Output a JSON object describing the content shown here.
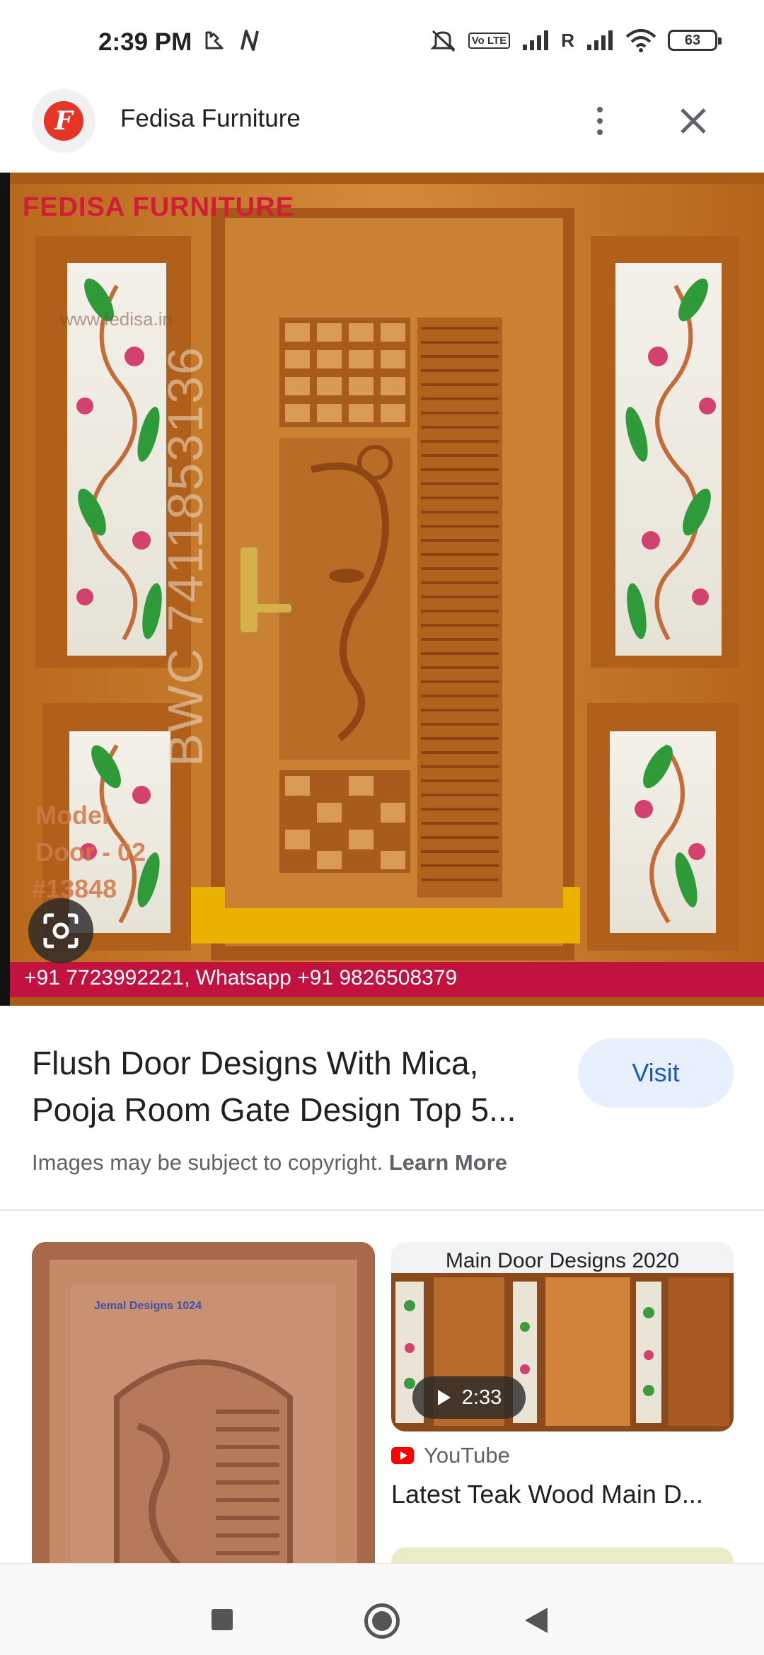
{
  "status_bar": {
    "time": "2:39 PM",
    "left_icons": [
      "notification-icon",
      "n-icon"
    ],
    "volte_label": "Vo LTE",
    "network_label": "R",
    "battery": "63"
  },
  "header": {
    "site_name": "Fedisa Furniture",
    "logo_letter": "F"
  },
  "main_image": {
    "watermark_brand": "FEDISA FURNITURE",
    "watermark_url": "www.fedisa.in",
    "vertical_code": "BWC 7411853136",
    "model_line1": "Model",
    "model_line2": "Door - 02",
    "model_line3": "#13848",
    "contact_banner": "+91 7723992221, Whatsapp +91 9826508379"
  },
  "result": {
    "title": "Flush Door Designs With Mica, Pooja Room Gate Design Top 5...",
    "visit_label": "Visit",
    "copyright_text": "Images may be subject to copyright.",
    "learn_more": "Learn More"
  },
  "related": {
    "left_card_caption": "Jemal Designs 1024",
    "right_card": {
      "header_text": "Main Door Designs 2020",
      "duration": "2:33",
      "source": "YouTube",
      "title": "Latest Teak Wood Main D..."
    }
  },
  "colors": {
    "accent_blue": "#1a56c4",
    "visit_bg": "#e8f0fe",
    "banner_red": "#c2123f",
    "logo_red": "#e53525"
  }
}
